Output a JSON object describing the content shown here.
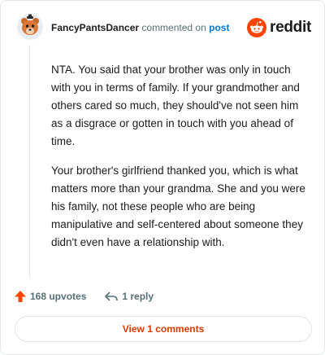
{
  "header": {
    "author": "FancyPantsDancer",
    "action_text": "commented on",
    "post_link": "post",
    "brand": "reddit"
  },
  "comment": {
    "paragraphs": [
      "NTA. You said that your brother was only in touch with you in terms of family. If your grandmother and others cared so much, they should've not seen him as a disgrace or gotten in touch with you ahead of time.",
      "Your brother's girlfriend thanked you, which is what matters more than your grandma. She and you were his family, not these people who are being manipulative and self-centered about someone they didn't even have a relationship with."
    ]
  },
  "actions": {
    "upvotes": "168 upvotes",
    "reply": "1 reply"
  },
  "footer": {
    "view_comments": "View 1 comments"
  },
  "colors": {
    "brand_orange": "#ff4500",
    "link_blue": "#0079d3",
    "view_text": "#d93a00"
  },
  "icons": [
    "avatar-bear",
    "reddit-logo-icon",
    "upvote-arrow-icon",
    "reply-icon"
  ]
}
